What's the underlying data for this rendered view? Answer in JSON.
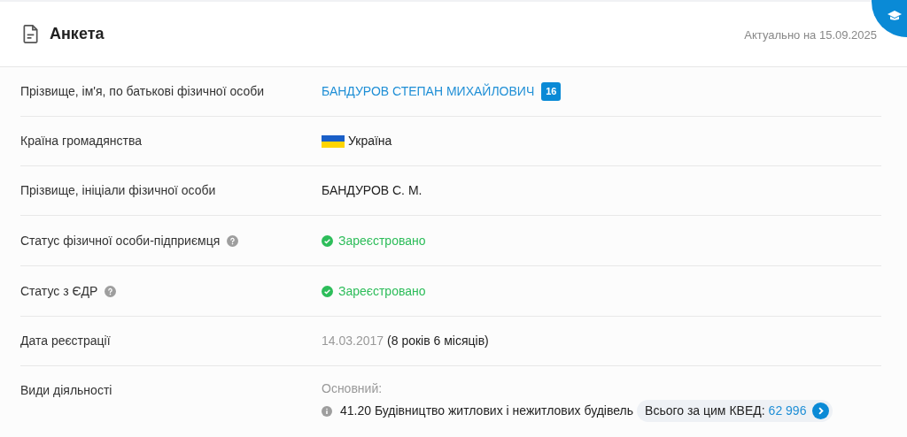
{
  "header": {
    "title": "Анкета",
    "updated": "Актуально на 15.09.2025"
  },
  "rows": [
    {
      "kind": "name",
      "label": "Прізвище, ім'я, по батькові фізичної особи",
      "value": "БАНДУРОВ СТЕПАН МИХАЙЛОВИЧ",
      "badge": "16"
    },
    {
      "kind": "country",
      "label": "Країна громадянства",
      "value": "Україна"
    },
    {
      "kind": "text",
      "label": "Прізвище, ініціали фізичної особи",
      "value": "БАНДУРОВ С. М."
    },
    {
      "kind": "status",
      "label": "Статус фізичної особи-підприємця",
      "help": true,
      "value": "Зареєстровано"
    },
    {
      "kind": "status",
      "label": "Статус з ЄДР",
      "help": true,
      "value": "Зареєстровано"
    },
    {
      "kind": "date",
      "label": "Дата реєстрації",
      "value": "14.03.2017",
      "note": "(8 років 6 місяців)"
    },
    {
      "kind": "activities",
      "label": "Види діяльності",
      "caption": "Основний:",
      "value": "41.20 Будівництво житлових і нежитлових будівель",
      "total_label": "Всього за цим КВЕД:",
      "total": "62 996"
    }
  ]
}
